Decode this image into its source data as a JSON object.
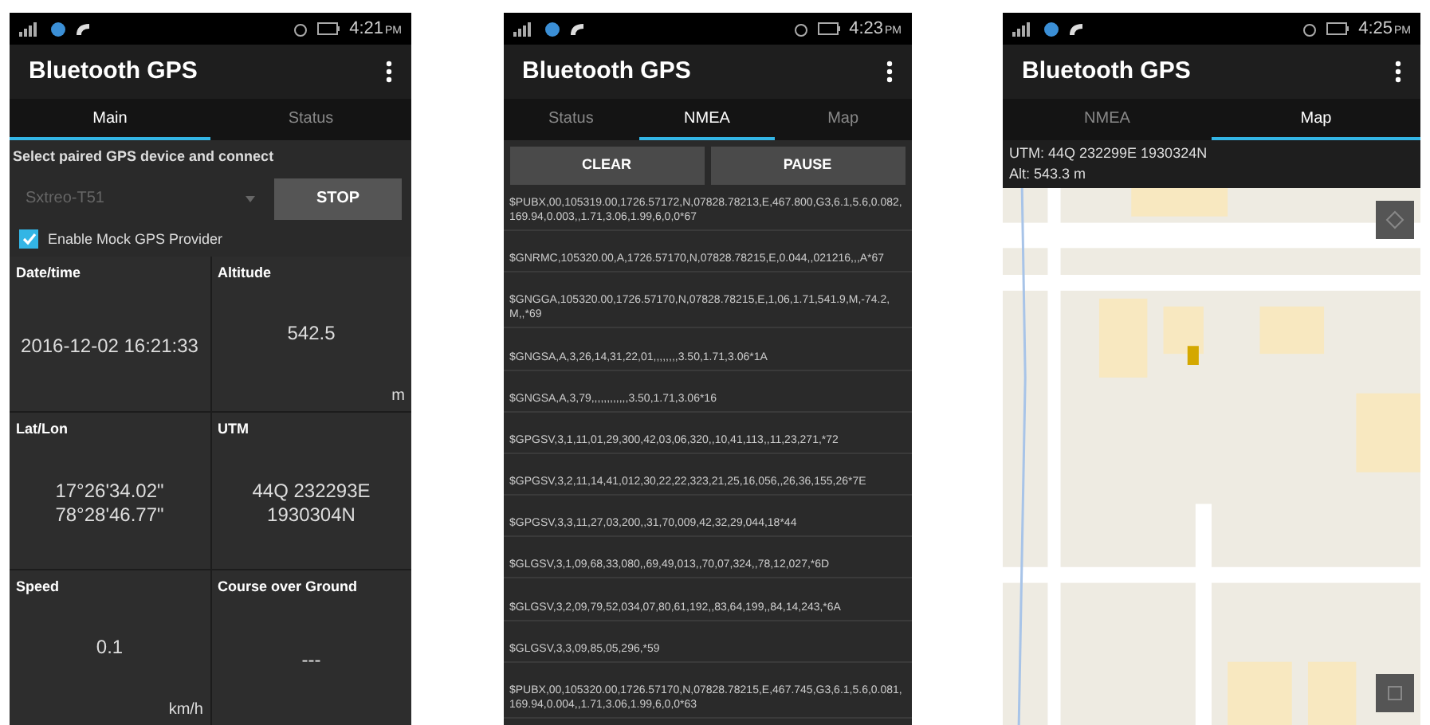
{
  "screens": [
    {
      "kind": "main",
      "status_bar": {
        "time": "4:21",
        "ampm": "PM"
      },
      "title": "Bluetooth GPS",
      "tabs": [
        {
          "label": "Main",
          "selected": true
        },
        {
          "label": "Status",
          "selected": false
        }
      ],
      "prompt": "Select paired GPS device and connect",
      "device": {
        "value": "Sxtreo-T51",
        "disabled": true
      },
      "stop_button": "STOP",
      "mock_checkbox": {
        "label": "Enable Mock GPS Provider",
        "checked": true
      },
      "cells": [
        {
          "label": "Date/time",
          "value_lines": [
            "2016-12-02 16:21:33"
          ]
        },
        {
          "label": "Altitude",
          "value_lines": [
            "542.5"
          ],
          "unit": "m"
        },
        {
          "label": "Lat/Lon",
          "value_lines": [
            "17°26'34.02\"",
            "78°28'46.77\""
          ]
        },
        {
          "label": "UTM",
          "value_lines": [
            "44Q 232293E",
            "1930304N"
          ]
        },
        {
          "label": "Speed",
          "value_lines": [
            "0.1"
          ],
          "unit": "km/h"
        },
        {
          "label": "Course over Ground",
          "value_lines": [
            "---"
          ]
        }
      ]
    },
    {
      "kind": "nmea",
      "status_bar": {
        "time": "4:23",
        "ampm": "PM"
      },
      "title": "Bluetooth GPS",
      "tabs": [
        {
          "label": "Status",
          "selected": false
        },
        {
          "label": "NMEA",
          "selected": true
        },
        {
          "label": "Map",
          "selected": false
        }
      ],
      "buttons": [
        "CLEAR",
        "PAUSE"
      ],
      "sentences": [
        "$PUBX,00,105319.00,1726.57172,N,07828.78213,E,467.800,G3,6.1,5.6,0.082,169.94,0.003,,1.71,3.06,1.99,6,0,0*67",
        "$GNRMC,105320.00,A,1726.57170,N,07828.78215,E,0.044,,021216,,,A*67",
        "$GNGGA,105320.00,1726.57170,N,07828.78215,E,1,06,1.71,541.9,M,-74.2,M,,*69",
        "$GNGSA,A,3,26,14,31,22,01,,,,,,,,3.50,1.71,3.06*1A",
        "$GNGSA,A,3,79,,,,,,,,,,,,3.50,1.71,3.06*16",
        "$GPGSV,3,1,11,01,29,300,42,03,06,320,,10,41,113,,11,23,271,*72",
        "$GPGSV,3,2,11,14,41,012,30,22,22,323,21,25,16,056,,26,36,155,26*7E",
        "$GPGSV,3,3,11,27,03,200,,31,70,009,42,32,29,044,18*44",
        "$GLGSV,3,1,09,68,33,080,,69,49,013,,70,07,324,,78,12,027,*6D",
        "$GLGSV,3,2,09,79,52,034,07,80,61,192,,83,64,199,,84,14,243,*6A",
        "$GLGSV,3,3,09,85,05,296,*59",
        "$PUBX,00,105320.00,1726.57170,N,07828.78215,E,467.745,G3,6.1,5.6,0.081,169.94,0.004,,1.71,3.06,1.99,6,0,0*63"
      ]
    },
    {
      "kind": "map",
      "status_bar": {
        "time": "4:25",
        "ampm": "PM"
      },
      "title": "Bluetooth GPS",
      "tabs": [
        {
          "label": "NMEA",
          "selected": false
        },
        {
          "label": "Map",
          "selected": true
        }
      ],
      "info_lines": [
        "UTM: 44Q 232299E 1930324N",
        "Alt: 543.3 m"
      ]
    }
  ]
}
